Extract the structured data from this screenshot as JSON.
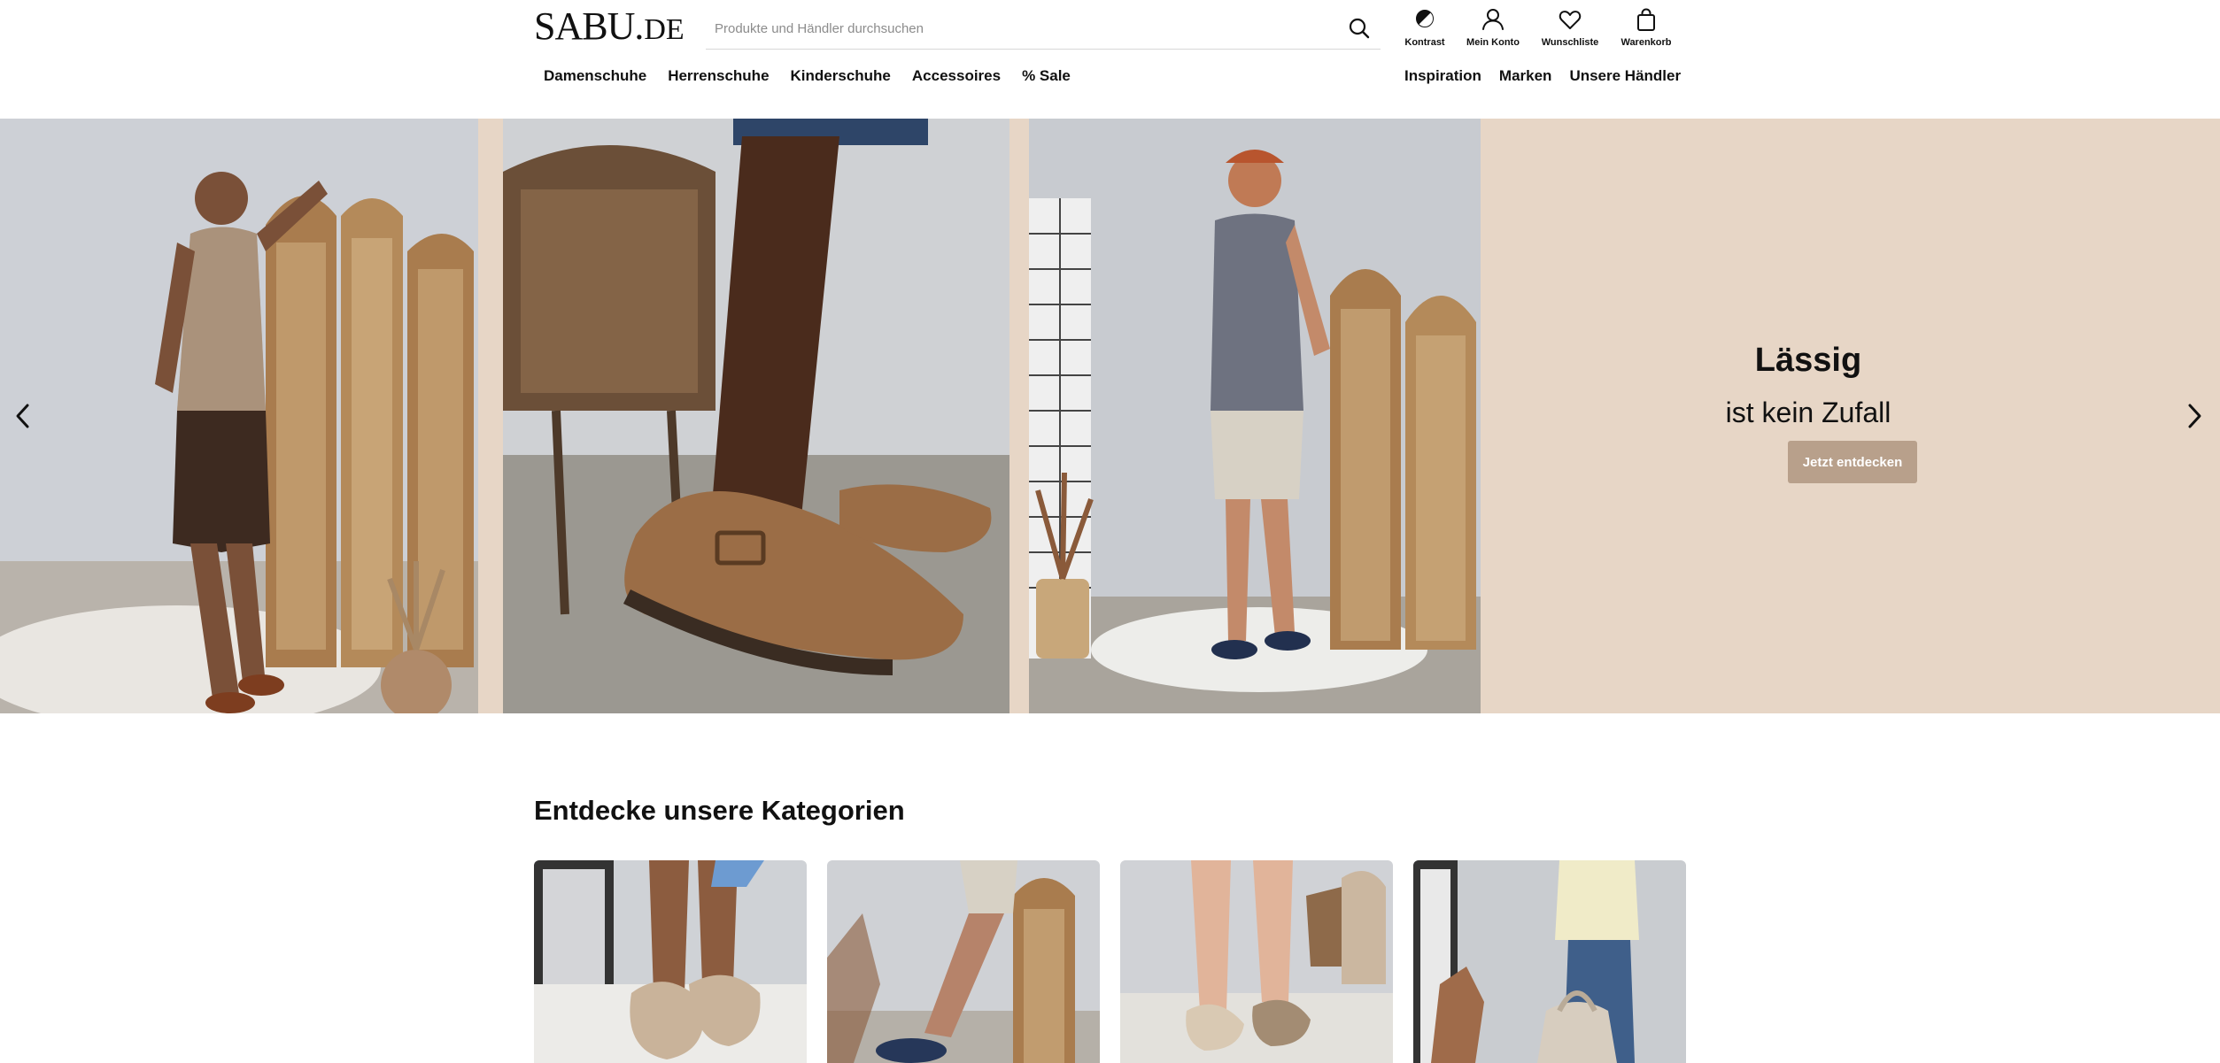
{
  "header": {
    "logo": {
      "main": "SABU",
      "dot": ".",
      "tld": "DE"
    },
    "search": {
      "placeholder": "Produkte und Händler durchsuchen"
    },
    "utilities": [
      {
        "label": "Kontrast",
        "icon": "contrast-icon"
      },
      {
        "label": "Mein Konto",
        "icon": "user-icon"
      },
      {
        "label": "Wunschliste",
        "icon": "heart-icon"
      },
      {
        "label": "Warenkorb",
        "icon": "bag-icon"
      }
    ]
  },
  "nav": {
    "left": [
      "Damenschuhe",
      "Herrenschuhe",
      "Kinderschuhe",
      "Accessoires",
      "% Sale"
    ],
    "right": [
      "Inspiration",
      "Marken",
      "Unsere Händler"
    ]
  },
  "hero": {
    "title": "Lässig",
    "subtitle": "ist kein Zufall",
    "button": "Jetzt entdecken",
    "background_color": "#e7d6c6",
    "button_color": "#b8a08b",
    "prev_icon": "chevron-left-icon",
    "next_icon": "chevron-right-icon"
  },
  "categories": {
    "title": "Entdecke unsere Kategorien"
  }
}
